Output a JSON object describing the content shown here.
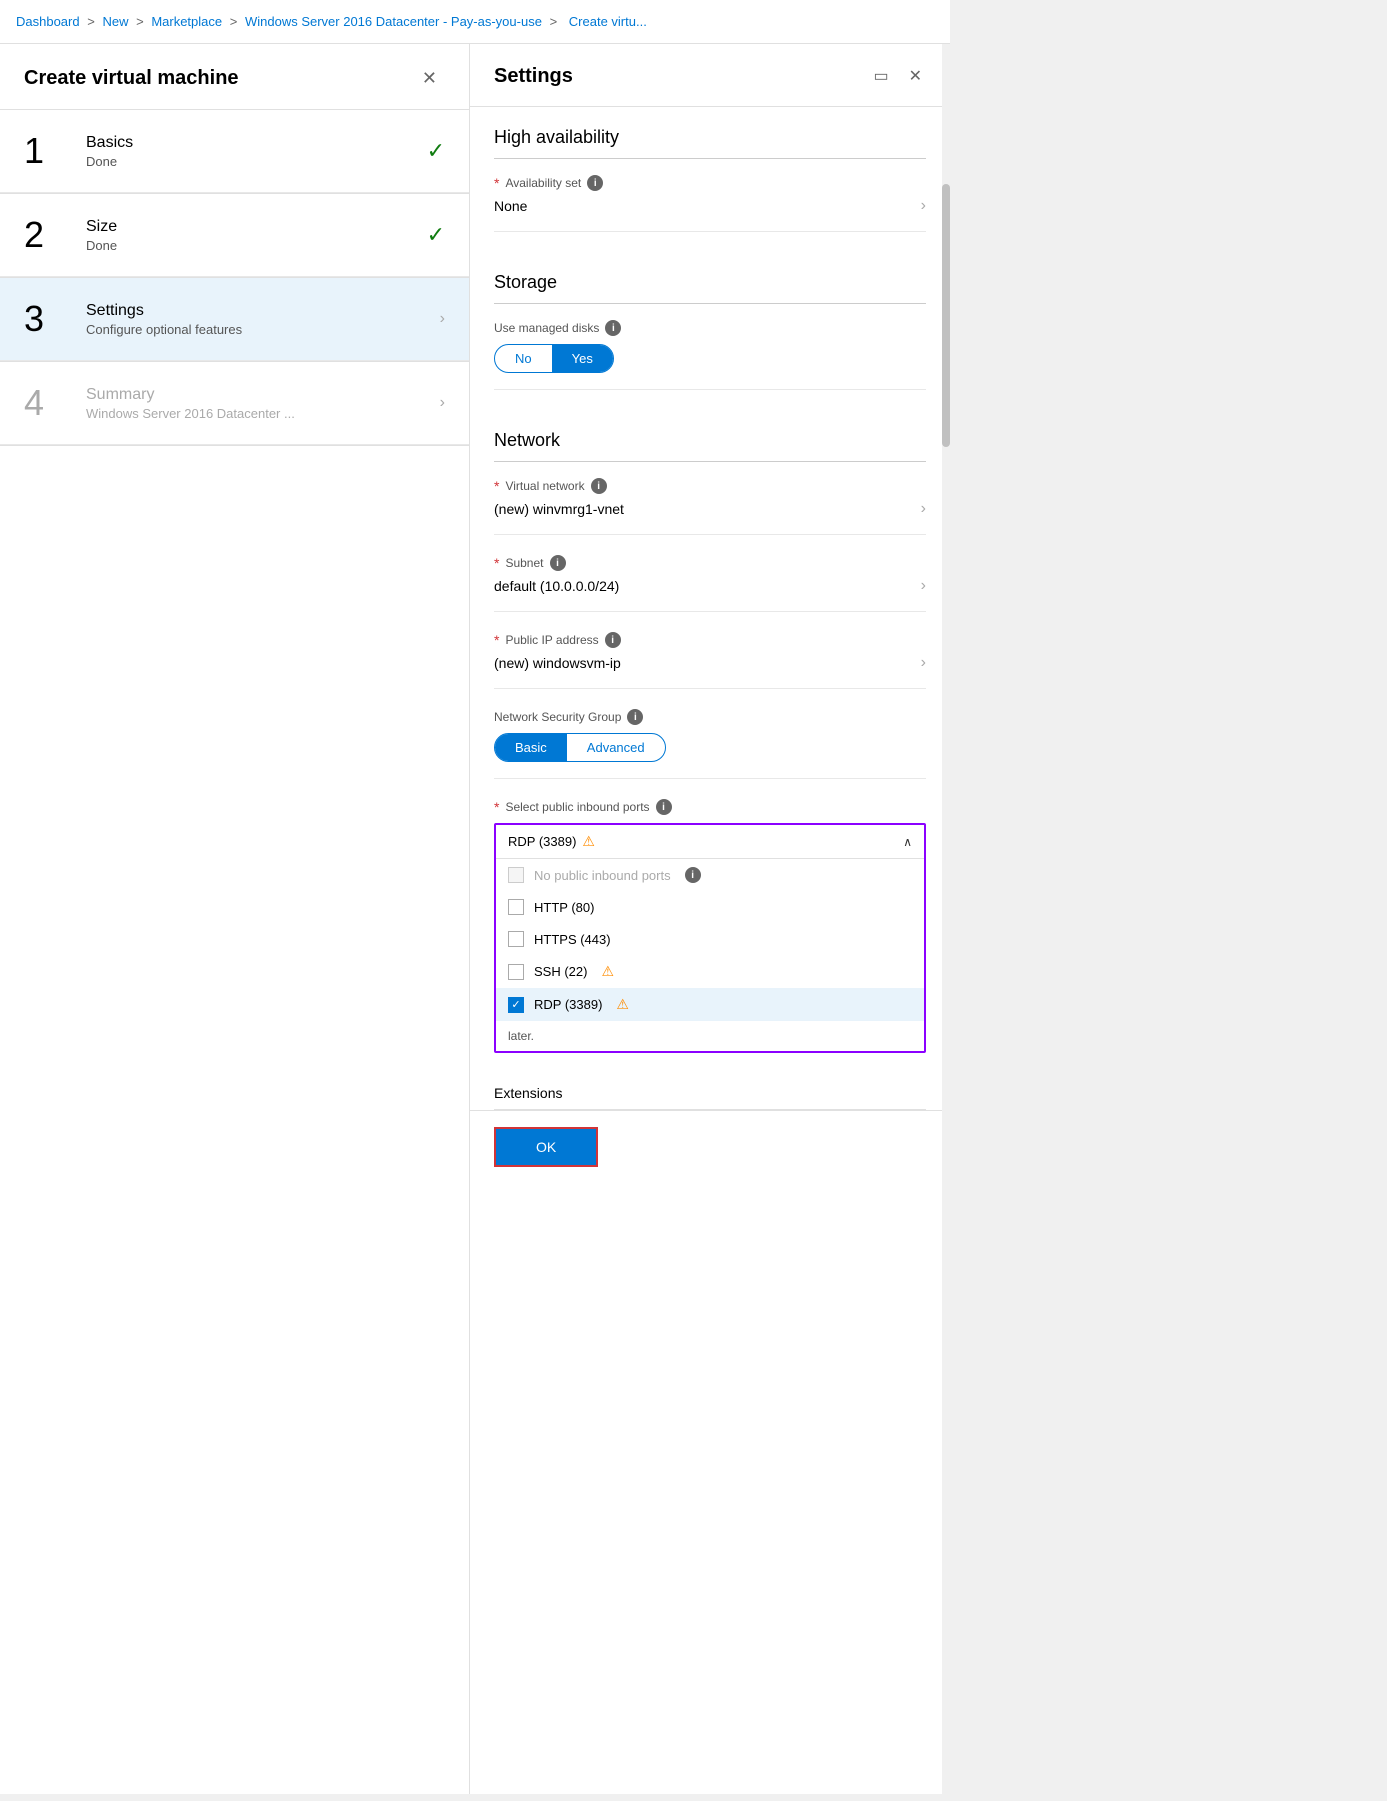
{
  "breadcrumb": {
    "items": [
      "Dashboard",
      "New",
      "Marketplace",
      "Windows Server 2016 Datacenter - Pay-as-you-use",
      "Create virtu..."
    ],
    "separators": [
      ">",
      ">",
      ">",
      ">"
    ]
  },
  "left_panel": {
    "title": "Create virtual machine",
    "close_label": "✕",
    "steps": [
      {
        "number": "1",
        "title": "Basics",
        "subtitle": "Done",
        "status": "done",
        "active": false
      },
      {
        "number": "2",
        "title": "Size",
        "subtitle": "Done",
        "status": "done",
        "active": false
      },
      {
        "number": "3",
        "title": "Settings",
        "subtitle": "Configure optional features",
        "status": "active",
        "active": true
      },
      {
        "number": "4",
        "title": "Summary",
        "subtitle": "Windows Server 2016 Datacenter ...",
        "status": "inactive",
        "active": false
      }
    ]
  },
  "right_panel": {
    "title": "Settings",
    "sections": {
      "high_availability": {
        "title": "High availability",
        "availability_set": {
          "label": "Availability set",
          "value": "None",
          "required": true
        }
      },
      "storage": {
        "title": "Storage",
        "use_managed_disks": {
          "label": "Use managed disks",
          "options": [
            "No",
            "Yes"
          ],
          "selected": "Yes"
        }
      },
      "network": {
        "title": "Network",
        "virtual_network": {
          "label": "Virtual network",
          "value": "(new) winvmrg1-vnet",
          "required": true
        },
        "subnet": {
          "label": "Subnet",
          "value": "default (10.0.0.0/24)",
          "required": true
        },
        "public_ip": {
          "label": "Public IP address",
          "value": "(new) windowsvm-ip",
          "required": true
        },
        "nsg": {
          "label": "Network Security Group",
          "options": [
            "Basic",
            "Advanced"
          ],
          "selected": "Basic"
        },
        "select_ports": {
          "label": "Select public inbound ports",
          "current_value": "RDP (3389)",
          "dropdown_open": true,
          "options": [
            {
              "id": "none",
              "label": "No public inbound ports",
              "checked": false,
              "disabled": true,
              "warning": false
            },
            {
              "id": "http",
              "label": "HTTP (80)",
              "checked": false,
              "disabled": false,
              "warning": false
            },
            {
              "id": "https",
              "label": "HTTPS (443)",
              "checked": false,
              "disabled": false,
              "warning": false
            },
            {
              "id": "ssh",
              "label": "SSH (22)",
              "checked": false,
              "disabled": false,
              "warning": true
            },
            {
              "id": "rdp",
              "label": "RDP (3389)",
              "checked": true,
              "disabled": false,
              "warning": true
            }
          ],
          "hint": "later."
        }
      },
      "extensions": {
        "title": "Extensions"
      }
    },
    "ok_button": "OK"
  }
}
